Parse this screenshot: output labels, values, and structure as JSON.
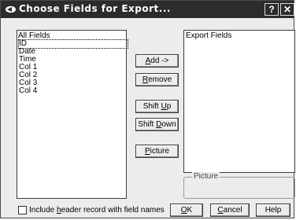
{
  "window": {
    "title": "Choose Fields for Export...",
    "help_glyph": "?",
    "close_glyph": "✕"
  },
  "all_fields": {
    "label": "All Fields",
    "items": [
      "ID",
      "Date",
      "Time",
      "Col 1",
      "Col 2",
      "Col 3",
      "Col 4"
    ],
    "selected": "ID"
  },
  "export_fields": {
    "label": "Export Fields",
    "items": []
  },
  "buttons": {
    "add": {
      "pre": "",
      "key": "A",
      "post": "dd ->"
    },
    "remove": {
      "pre": "",
      "key": "R",
      "post": "emove"
    },
    "shift_up": {
      "pre": "Shift ",
      "key": "U",
      "post": "p"
    },
    "shift_down": {
      "pre": "Shift ",
      "key": "D",
      "post": "own"
    },
    "picture": {
      "pre": "",
      "key": "P",
      "post": "icture"
    },
    "ok": {
      "pre": "",
      "key": "O",
      "post": "K"
    },
    "cancel": {
      "pre": "",
      "key": "C",
      "post": "ancel"
    },
    "help": {
      "pre": "Help",
      "key": "",
      "post": ""
    }
  },
  "picture_group": {
    "label": "Picture"
  },
  "include_header": {
    "pre": "Include ",
    "key": "h",
    "post": "eader record with field names",
    "checked": false
  },
  "icons": {
    "app": "export-arrow-icon",
    "help": "help-icon",
    "close": "close-icon"
  }
}
